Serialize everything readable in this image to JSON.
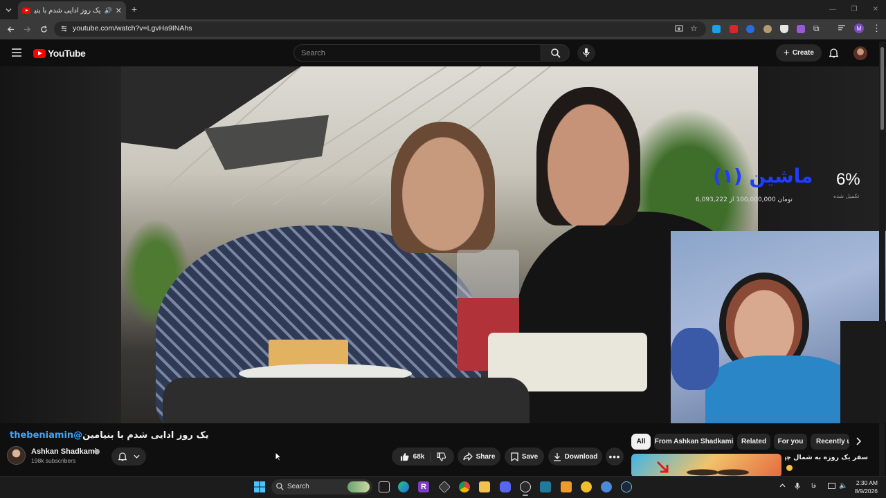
{
  "browser": {
    "tab_title": "یک روز ادایی شدم با بنیامین",
    "url": "youtube.com/watch?v=LgvHa9INAhs",
    "new_tab_label": "+"
  },
  "youtube": {
    "logo_text": "YouTube",
    "search_placeholder": "Search",
    "create_label": "Create"
  },
  "video": {
    "overlay": {
      "donation_title": "ماشین (۱)",
      "donation_amount": "تومان 100,000,000 از 6,093,222",
      "percent": "6%",
      "percent_caption": "تکمیل شده"
    }
  },
  "details": {
    "title_prefix": "یک روز ادایی شدم با بنیامین",
    "title_mention": "@thebeniamin",
    "channel_name": "Ashkan Shadkami",
    "subscribers": "198k subscribers",
    "like_count": "68k",
    "share_label": "Share",
    "save_label": "Save",
    "download_label": "Download"
  },
  "chips": [
    {
      "label": "All",
      "active": true
    },
    {
      "label": "From Ashkan Shadkami",
      "active": false
    },
    {
      "label": "Related",
      "active": false
    },
    {
      "label": "For you",
      "active": false
    },
    {
      "label": "Recently u",
      "active": false
    }
  ],
  "recommendation": {
    "title": "سفر یک روزه به شمال چهارتایی"
  },
  "taskbar": {
    "search_label": "Search",
    "language": "فا",
    "time": "2:30 AM",
    "date": "8/9/2026"
  },
  "colors": {
    "youtube_red": "#ff0000",
    "mention_blue": "#3ea6ff",
    "background": "#0f0f0f"
  }
}
